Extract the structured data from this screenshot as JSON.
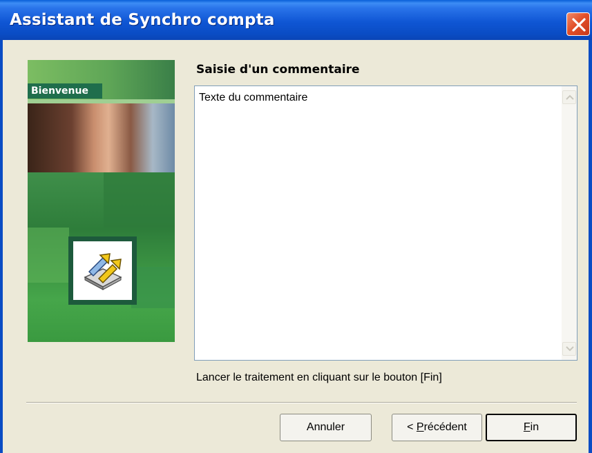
{
  "window": {
    "title": "Assistant de Synchro compta"
  },
  "banner": {
    "label": "Bienvenue",
    "icon": "sync-documents-icon"
  },
  "content": {
    "heading": "Saisie d'un commentaire",
    "comment_value": "Texte du commentaire",
    "hint": "Lancer le traitement en cliquant sur le bouton [Fin]"
  },
  "buttons": {
    "cancel_label": "Annuler",
    "prev_prefix": "< ",
    "prev_mnemonic": "P",
    "prev_rest": "récédent",
    "finish_mnemonic": "F",
    "finish_rest": "in"
  },
  "colors": {
    "titlebar": "#0a4cc4",
    "close": "#e2502a",
    "dialog_bg": "#ece9d8",
    "banner_green": "#2e7d3a"
  }
}
